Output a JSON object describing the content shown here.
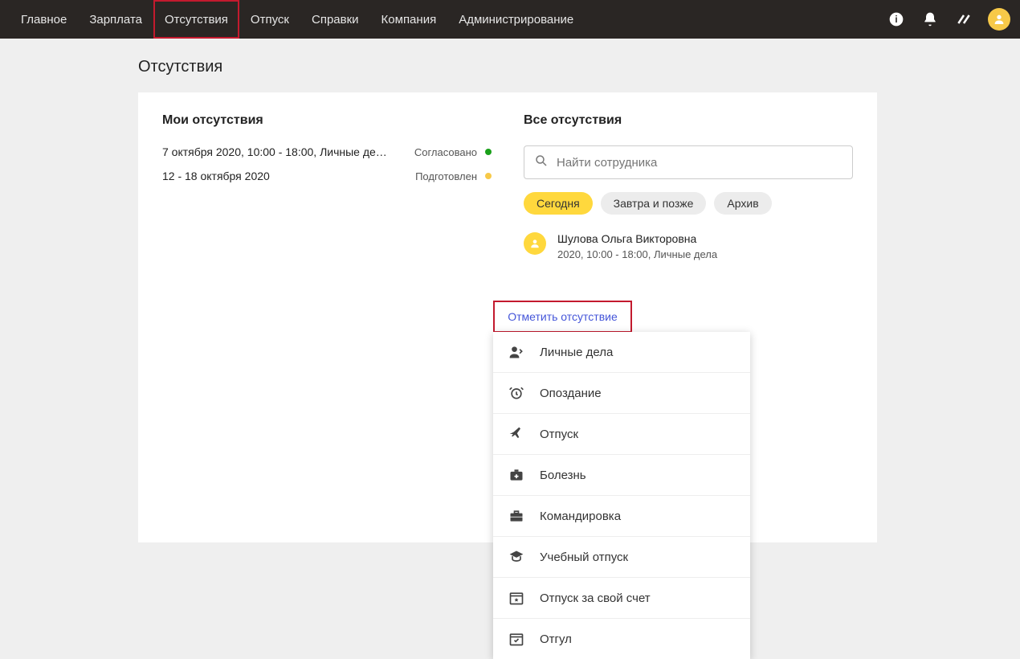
{
  "nav": {
    "items": [
      {
        "label": "Главное"
      },
      {
        "label": "Зарплата"
      },
      {
        "label": "Отсутствия",
        "active": true
      },
      {
        "label": "Отпуск"
      },
      {
        "label": "Справки"
      },
      {
        "label": "Компания"
      },
      {
        "label": "Администрирование"
      }
    ]
  },
  "page": {
    "title": "Отсутствия"
  },
  "my_absences": {
    "title": "Мои отсутствия",
    "rows": [
      {
        "text": "7 октября 2020, 10:00 - 18:00, Личные де…",
        "status": "Согласовано",
        "color": "green"
      },
      {
        "text": "12 - 18 октября 2020",
        "status": "Подготовлен",
        "color": "yellow"
      }
    ],
    "mark_button": "Отметить отсутствие"
  },
  "all_absences": {
    "title": "Все отсутствия",
    "search_placeholder": "Найти сотрудника",
    "chips": [
      {
        "label": "Сегодня",
        "active": true
      },
      {
        "label": "Завтра и позже"
      },
      {
        "label": "Архив"
      }
    ],
    "person": {
      "name": "Шулова Ольга Викторовна",
      "detail": "2020, 10:00 - 18:00, Личные дела"
    }
  },
  "dropdown": {
    "items": [
      {
        "label": "Личные дела",
        "icon": "person"
      },
      {
        "label": "Опоздание",
        "icon": "alarm"
      },
      {
        "label": "Отпуск",
        "icon": "plane"
      },
      {
        "label": "Болезнь",
        "icon": "medkit"
      },
      {
        "label": "Командировка",
        "icon": "briefcase"
      },
      {
        "label": "Учебный отпуск",
        "icon": "graduation"
      },
      {
        "label": "Отпуск за свой счет",
        "icon": "calendar-star"
      },
      {
        "label": "Отгул",
        "icon": "calendar-check"
      }
    ]
  }
}
